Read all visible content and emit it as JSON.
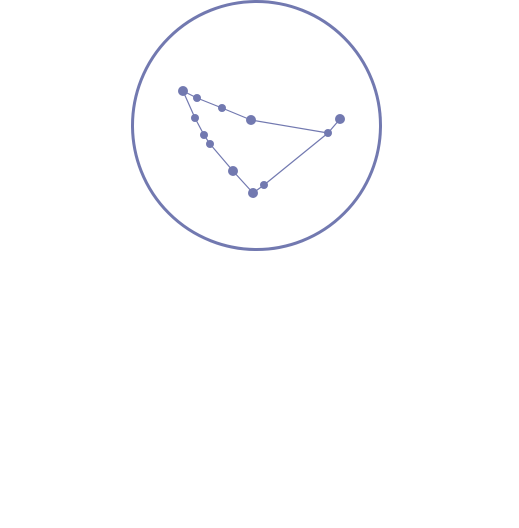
{
  "emblem": {
    "icon": "capricornus-constellation-icon",
    "color": "#7279b0"
  }
}
